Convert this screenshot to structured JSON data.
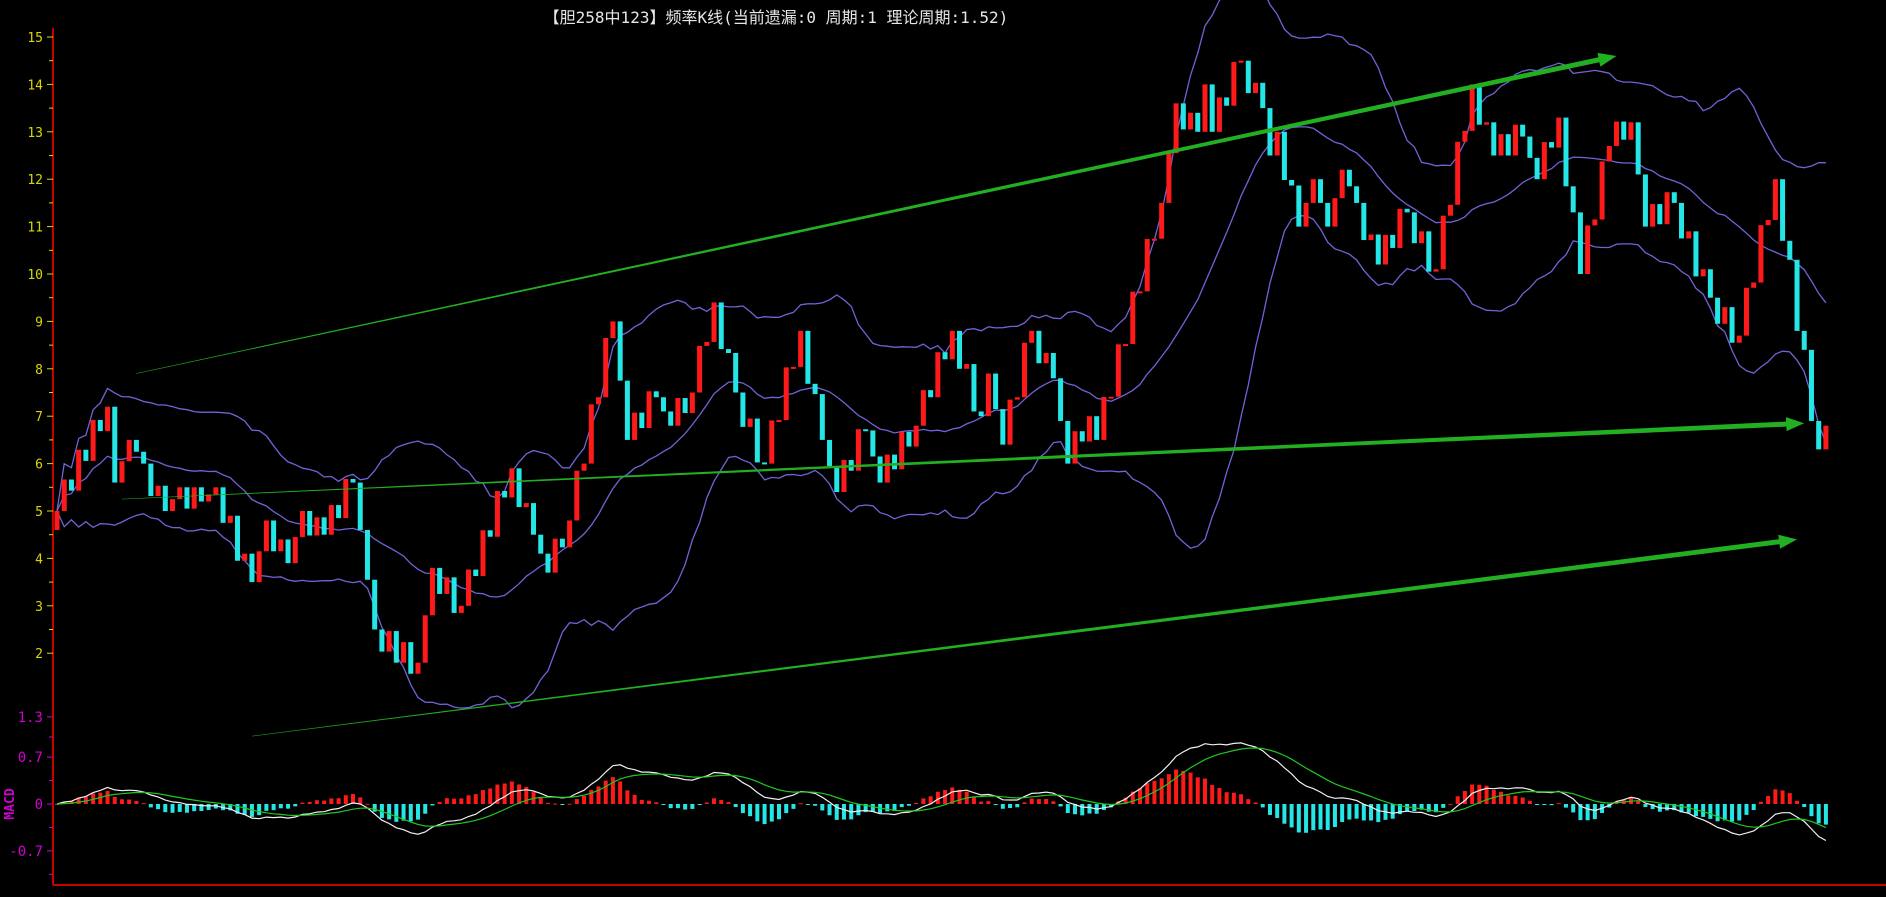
{
  "chart_data": {
    "type": "candlestick",
    "title": "【胆258中123】频率K线(当前遗漏:0 周期:1 理论周期:1.52)",
    "candle_count": 246,
    "close_keypoints": [
      [
        0,
        5.0
      ],
      [
        7,
        7.2
      ],
      [
        8,
        5.6
      ],
      [
        10,
        6.5
      ],
      [
        12,
        6.0
      ],
      [
        15,
        5.0
      ],
      [
        17,
        5.5
      ],
      [
        20,
        5.2
      ],
      [
        22,
        5.5
      ],
      [
        27,
        3.5
      ],
      [
        29,
        4.8
      ],
      [
        32,
        3.9
      ],
      [
        34,
        5.0
      ],
      [
        37,
        4.5
      ],
      [
        41,
        5.6
      ],
      [
        42,
        4.6
      ],
      [
        44,
        2.5
      ],
      [
        50,
        1.8
      ],
      [
        52,
        3.8
      ],
      [
        56,
        3.0
      ],
      [
        63,
        5.9
      ],
      [
        66,
        4.5
      ],
      [
        68,
        3.7
      ],
      [
        71,
        4.8
      ],
      [
        77,
        9.0
      ],
      [
        79,
        6.5
      ],
      [
        83,
        7.4
      ],
      [
        85,
        6.8
      ],
      [
        88,
        7.5
      ],
      [
        91,
        9.4
      ],
      [
        94,
        7.5
      ],
      [
        98,
        6.0
      ],
      [
        103,
        8.8
      ],
      [
        106,
        6.5
      ],
      [
        108,
        5.4
      ],
      [
        112,
        6.7
      ],
      [
        114,
        5.6
      ],
      [
        119,
        6.8
      ],
      [
        124,
        8.8
      ],
      [
        128,
        7.0
      ],
      [
        129,
        7.9
      ],
      [
        131,
        6.4
      ],
      [
        135,
        8.8
      ],
      [
        138,
        7.8
      ],
      [
        140,
        6.0
      ],
      [
        143,
        7.0
      ],
      [
        144,
        6.5
      ],
      [
        153,
        11.5
      ],
      [
        155,
        13.6
      ],
      [
        158,
        13.0
      ],
      [
        159,
        14.0
      ],
      [
        160,
        13.0
      ],
      [
        164,
        14.5
      ],
      [
        167,
        13.5
      ],
      [
        168,
        12.5
      ],
      [
        169,
        13.0
      ],
      [
        172,
        11.0
      ],
      [
        174,
        12.0
      ],
      [
        176,
        11.0
      ],
      [
        178,
        12.2
      ],
      [
        180,
        11.5
      ],
      [
        183,
        10.2
      ],
      [
        187,
        11.3
      ],
      [
        191,
        10.1
      ],
      [
        196,
        14.0
      ],
      [
        199,
        12.5
      ],
      [
        203,
        12.9
      ],
      [
        205,
        12.0
      ],
      [
        208,
        13.3
      ],
      [
        211,
        10.0
      ],
      [
        215,
        12.7
      ],
      [
        218,
        13.2
      ],
      [
        220,
        11.0
      ],
      [
        224,
        11.5
      ],
      [
        229,
        9.5
      ],
      [
        233,
        8.7
      ],
      [
        238,
        12.0
      ],
      [
        244,
        6.3
      ],
      [
        245,
        6.8
      ]
    ],
    "price_axis": {
      "ticks": [
        "15",
        "14",
        "13",
        "12",
        "11",
        "10",
        "9",
        "8",
        "7",
        "6",
        "5",
        "4",
        "3",
        "2"
      ],
      "range": [
        1.5,
        15
      ]
    },
    "macd_axis": {
      "label": "MACD",
      "ticks": [
        "1.3",
        "0.7",
        "0",
        "-0.7"
      ],
      "range": [
        -1.1,
        1.5
      ]
    },
    "bollinger": {
      "period": 20,
      "k": 2
    },
    "macd": {
      "fast": 12,
      "slow": 26,
      "signal": 9
    },
    "trendlines": [
      {
        "from": [
          11,
          7.9
        ],
        "to": [
          216,
          14.6
        ]
      },
      {
        "from": [
          9,
          5.25
        ],
        "to": [
          242,
          6.85
        ]
      },
      {
        "from": [
          27,
          0.25
        ],
        "to": [
          241,
          4.4
        ]
      }
    ],
    "colors": {
      "up": "#ff1a1a",
      "down": "#25e6e6",
      "band": "#6f64d8",
      "dif": "#f0f0f0",
      "dea": "#1ec81e",
      "trend": "#22b022",
      "axis": "#c80000",
      "price_label": "#d8d800",
      "macd_label": "#d000d0"
    }
  }
}
